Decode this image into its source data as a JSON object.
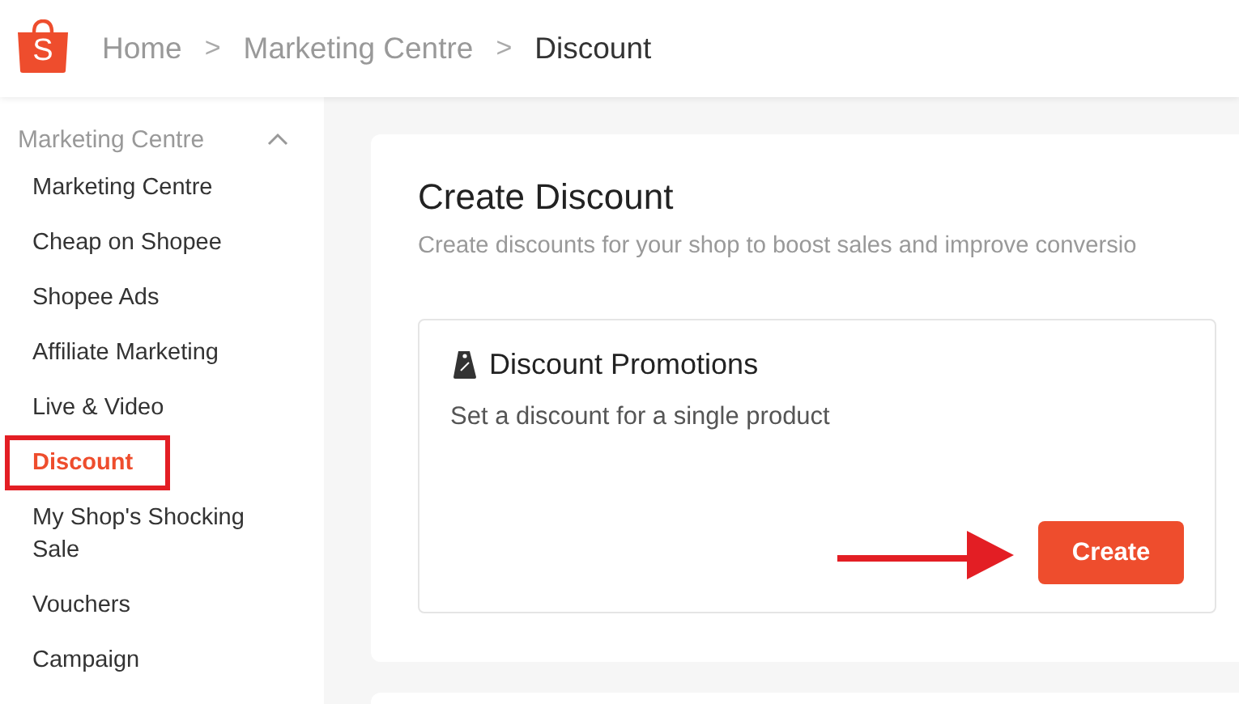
{
  "logo": {
    "letter": "S"
  },
  "breadcrumb": [
    {
      "label": "Home",
      "current": false
    },
    {
      "label": "Marketing Centre",
      "current": false
    },
    {
      "label": "Discount",
      "current": true
    }
  ],
  "breadcrumb_separator": ">",
  "sidebar": {
    "title": "Marketing Centre",
    "expanded": true,
    "items": [
      {
        "label": "Marketing Centre",
        "selected": false,
        "highlighted": false
      },
      {
        "label": "Cheap on Shopee",
        "selected": false,
        "highlighted": false
      },
      {
        "label": "Shopee Ads",
        "selected": false,
        "highlighted": false
      },
      {
        "label": "Affiliate Marketing",
        "selected": false,
        "highlighted": false
      },
      {
        "label": "Live & Video",
        "selected": false,
        "highlighted": false
      },
      {
        "label": "Discount",
        "selected": true,
        "highlighted": true
      },
      {
        "label": "My Shop's Shocking Sale",
        "selected": false,
        "highlighted": false
      },
      {
        "label": "Vouchers",
        "selected": false,
        "highlighted": false
      },
      {
        "label": "Campaign",
        "selected": false,
        "highlighted": false
      }
    ]
  },
  "page": {
    "title": "Create Discount",
    "subtitle": "Create discounts for your shop to boost sales and improve conversio",
    "cards": [
      {
        "title": "Discount Promotions",
        "description": "Set a discount for a single product",
        "button": "Create",
        "pointer_arrow": true
      }
    ]
  }
}
